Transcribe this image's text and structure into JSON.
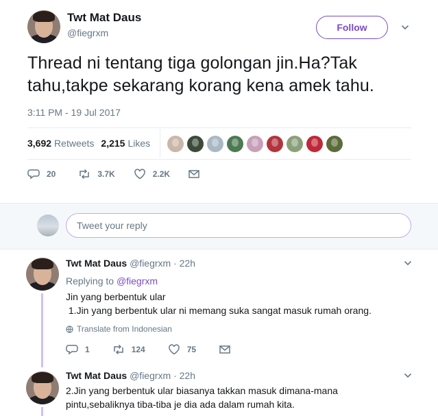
{
  "main_tweet": {
    "author_name": "Twt Mat Daus",
    "author_handle": "@fiegrxm",
    "follow_label": "Follow",
    "text": "Thread ni tentang tiga golongan jin.Ha?Tak tahu,takpe sekarang korang kena amek tahu.",
    "timestamp": "3:11 PM - 19 Jul 2017",
    "retweets_count": "3,692",
    "retweets_label": "Retweets",
    "likes_count": "2,215",
    "likes_label": "Likes",
    "liker_avatars": [
      "#c9b7a8",
      "#3c4a3a",
      "#a9b8c4",
      "#4c7a52",
      "#c7a0b8",
      "#b3343c",
      "#8aa07a",
      "#c02838",
      "#5b6b3a"
    ],
    "actions": {
      "replies": "20",
      "retweets": "3.7K",
      "likes": "2.2K"
    }
  },
  "reply_box": {
    "placeholder": "Tweet your reply"
  },
  "replies": [
    {
      "author_name": "Twt Mat Daus",
      "author_handle": "@fiegrxm",
      "time": "· 22h",
      "replying_to_label": "Replying to",
      "replying_to_handle": "@fiegrxm",
      "text_line1": "Jin yang berbentuk ular",
      "text_line2": " 1.Jin yang berbentuk ular ni memang suka sangat masuk rumah orang.",
      "translate_label": "Translate from Indonesian",
      "actions": {
        "replies": "1",
        "retweets": "124",
        "likes": "75"
      }
    },
    {
      "author_name": "Twt Mat Daus",
      "author_handle": "@fiegrxm",
      "time": "· 22h",
      "text_line1": "2.Jin yang berbentuk ular biasanya takkan masuk dimana-mana",
      "text_line2": "pintu,sebaliknya tiba-tiba je dia ada dalam rumah kita."
    }
  ],
  "colors": {
    "accent": "#794bc4",
    "secondary_text": "#657786",
    "primary_text": "#14171a",
    "thread_line": "#d2bff5"
  }
}
